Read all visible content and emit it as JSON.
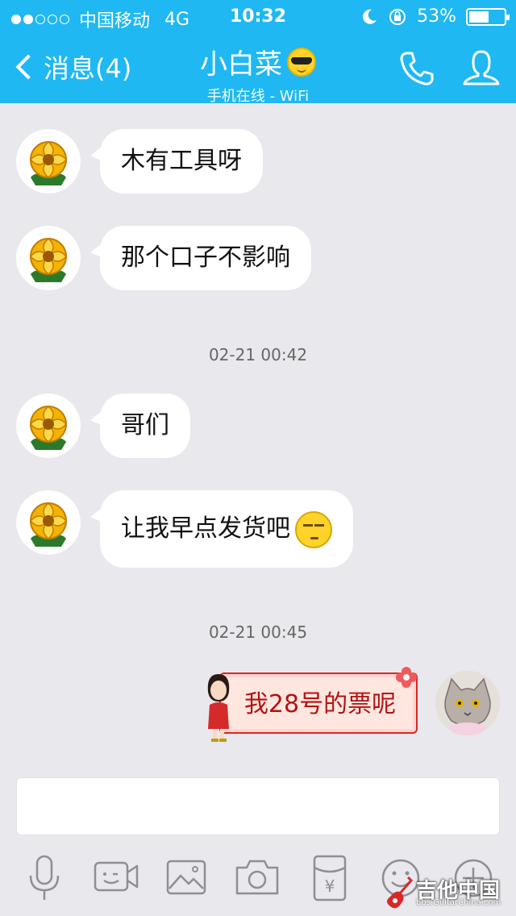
{
  "status_bar": {
    "carrier": "中国移动",
    "network": "4G",
    "time": "10:32",
    "battery_text": "53%",
    "battery_level": 0.53,
    "signal_bars_filled": 2,
    "signal_bars_total": 5
  },
  "nav": {
    "back_label": "消息(4)",
    "contact_name": "小白菜",
    "contact_status": "手机在线 - WiFi"
  },
  "messages": [
    {
      "sender": "contact",
      "text": "木有工具呀"
    },
    {
      "sender": "contact",
      "text": "那个口子不影响"
    },
    {
      "timestamp": "02-21 00:42"
    },
    {
      "sender": "contact",
      "text": "哥们"
    },
    {
      "sender": "contact",
      "text": "让我早点发货吧",
      "emoji": "unamused-face-icon"
    },
    {
      "timestamp": "02-21 00:45"
    },
    {
      "sender": "me",
      "text": "我28号的票呢",
      "style": "red-festive-card"
    }
  ],
  "toolbar": {
    "items": [
      "microphone-icon",
      "video-call-icon",
      "image-icon",
      "camera-icon",
      "red-packet-icon",
      "emoji-icon",
      "plus-icon"
    ]
  },
  "watermark": {
    "text": "吉他中国",
    "url": "bbs.GuitarChina.com"
  },
  "colors": {
    "header": "#1fb8f2",
    "background": "#e8e8ed",
    "bubble": "#ffffff",
    "card_border": "#d92727",
    "card_text": "#b51212"
  }
}
